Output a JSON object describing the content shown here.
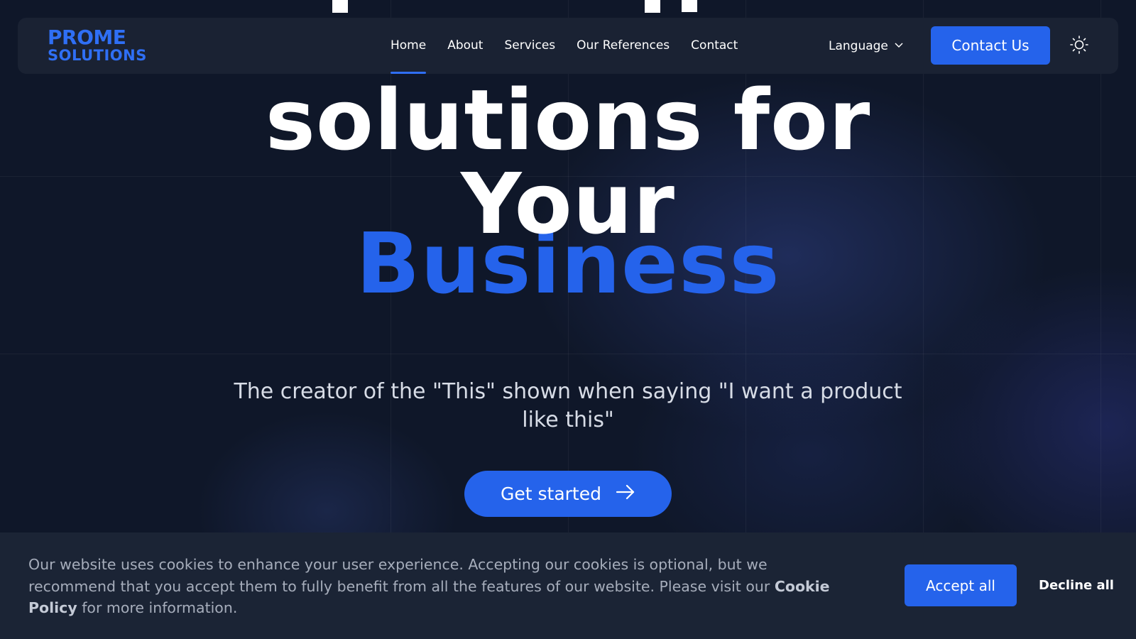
{
  "brand": {
    "logo_top": "PROME",
    "logo_bottom": "SOLUTIONS",
    "accent_color": "#2563eb"
  },
  "nav": {
    "links": [
      {
        "label": "Home",
        "active": true
      },
      {
        "label": "About",
        "active": false
      },
      {
        "label": "Services",
        "active": false
      },
      {
        "label": "Our References",
        "active": false
      },
      {
        "label": "Contact",
        "active": false
      }
    ],
    "language_label": "Language",
    "contact_button": "Contact Us",
    "theme_icon": "sun-icon"
  },
  "hero": {
    "line_1": "solutions for",
    "line_2": "Your",
    "line_3": "Business",
    "subtitle": "The creator of the \"This\" shown when saying \"I want a product like this\"",
    "cta_label": "Get started",
    "cta_icon": "arrow-right-icon"
  },
  "cookie_banner": {
    "text_before": "Our website uses cookies to enhance your user experience. Accepting our cookies is optional, but we recommend that you accept them to fully benefit from all the features of our website. Please visit our ",
    "policy_link": "Cookie Policy",
    "text_after": " for more information.",
    "accept_label": "Accept all",
    "decline_label": "Decline all"
  }
}
